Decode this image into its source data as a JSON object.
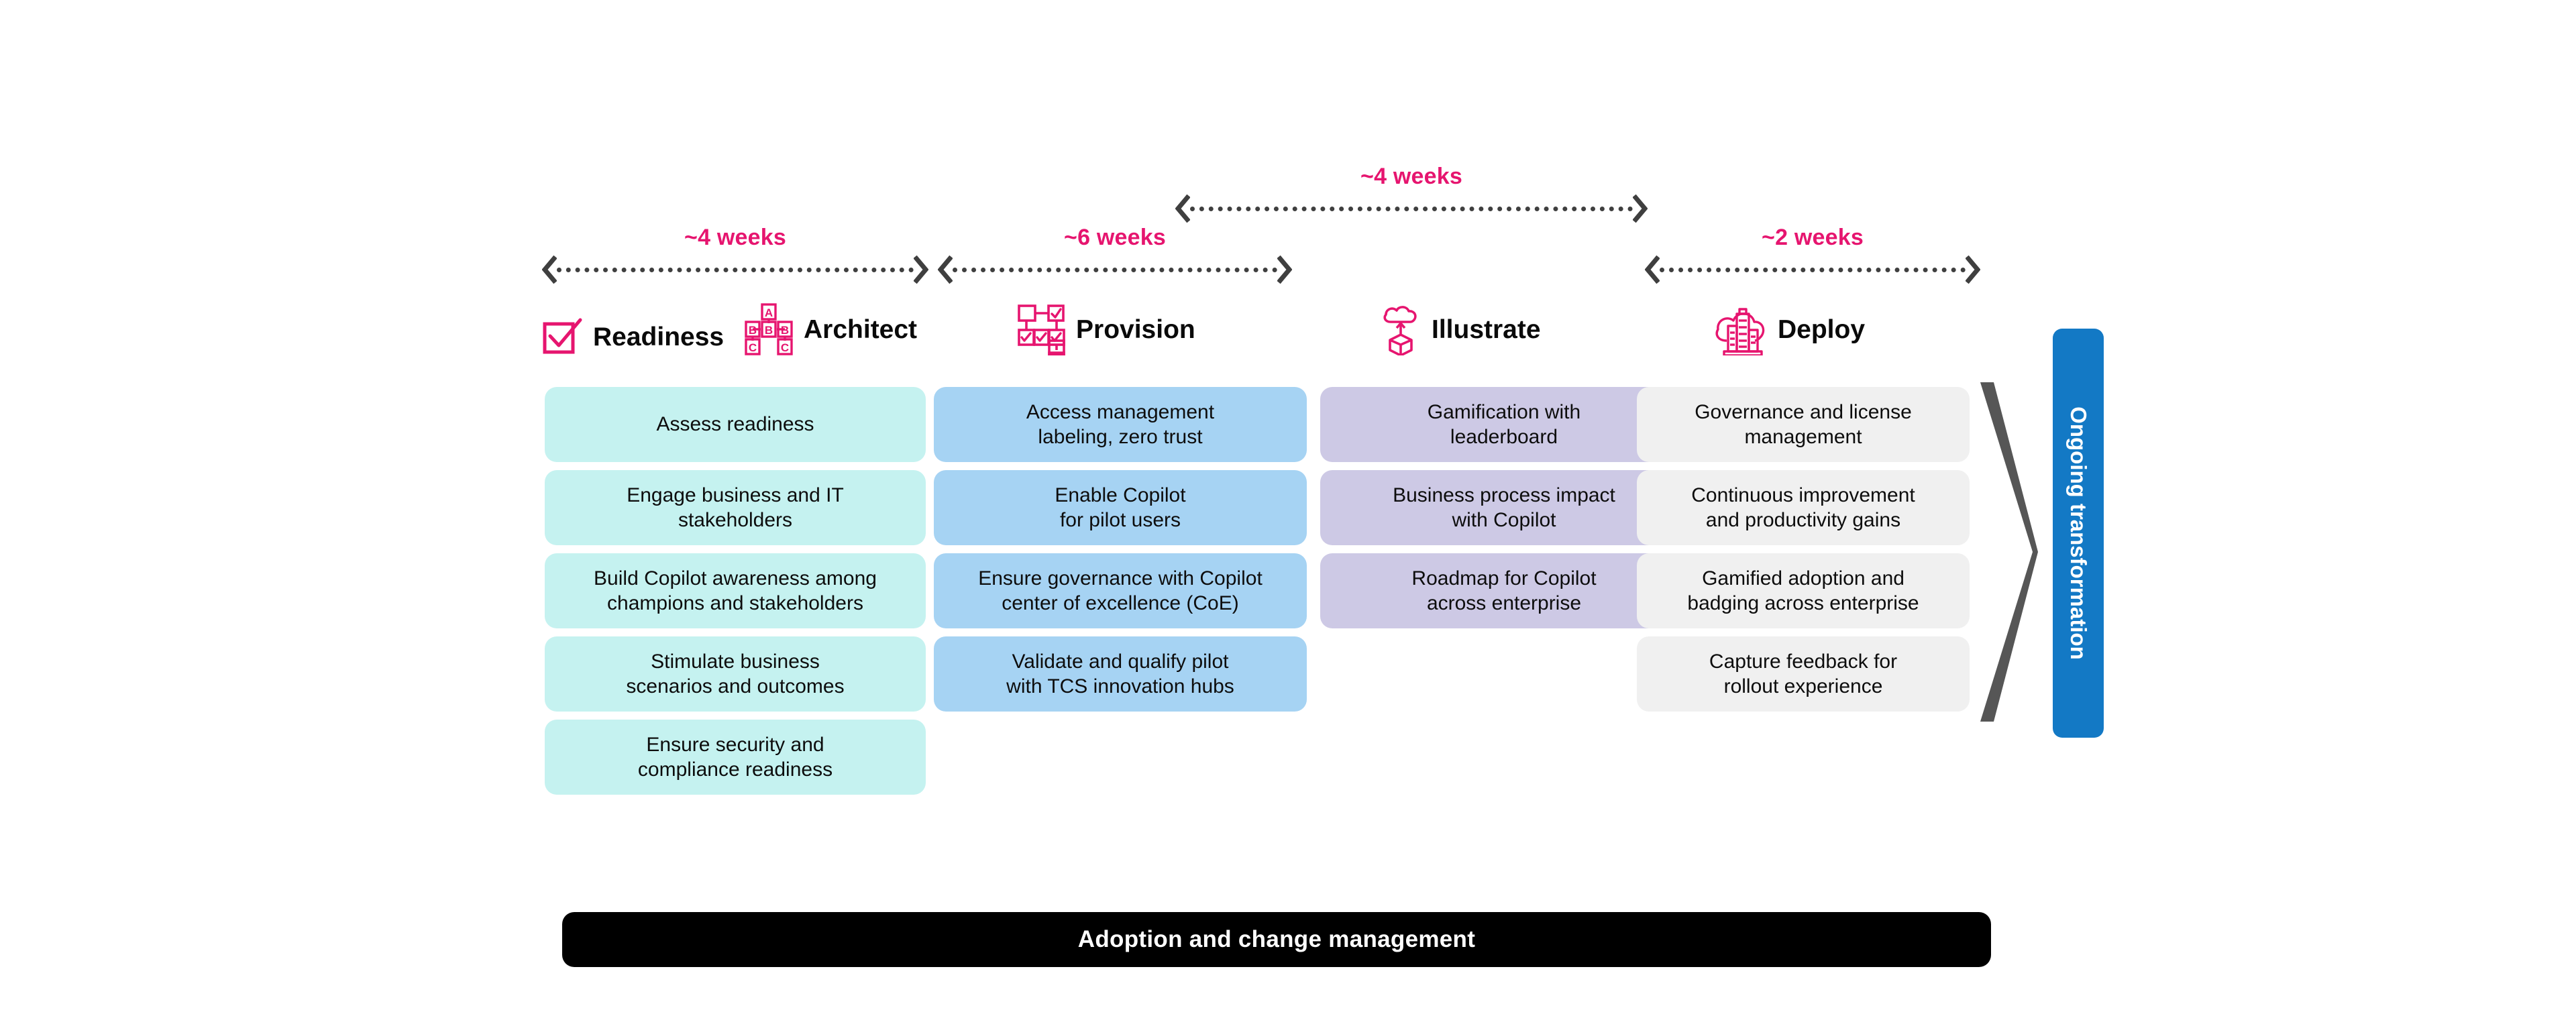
{
  "accent": {
    "pink": "#E6156F",
    "arrow_gray": "#3F3F3F",
    "big_chevron_gray": "#565656",
    "ongoing_blue": "#1379C5",
    "card_teal": "#C5F2F0",
    "card_blue": "#A6D3F3",
    "card_purple": "#CDC9E5",
    "card_gray": "#F0F0F0",
    "bar_black": "#000000"
  },
  "durations": [
    {
      "id": "d1",
      "label": "~4 weeks"
    },
    {
      "id": "d2",
      "label": "~6 weeks"
    },
    {
      "id": "d3",
      "label": "~4 weeks"
    },
    {
      "id": "d4",
      "label": "~2 weeks"
    }
  ],
  "phases": [
    {
      "id": "readiness",
      "title": "Readiness",
      "icon": "checkbox-check-icon",
      "card_style": "teal",
      "items": [
        "Assess readiness",
        "Engage business and IT\nstakeholders",
        "Build Copilot awareness among\nchampions and stakeholders",
        "Stimulate business\nscenarios and outcomes",
        "Ensure security and\ncompliance readiness"
      ]
    },
    {
      "id": "architect",
      "title": "Architect",
      "icon": "org-chart-abc-icon",
      "card_style": "teal",
      "items": []
    },
    {
      "id": "provision",
      "title": "Provision",
      "icon": "checklist-nodes-icon",
      "card_style": "blue",
      "items": [
        "Access management\nlabeling, zero trust",
        "Enable Copilot\nfor pilot users",
        "Ensure governance with Copilot\ncenter of excellence (CoE)",
        "Validate and qualify pilot\nwith TCS innovation hubs"
      ]
    },
    {
      "id": "illustrate",
      "title": "Illustrate",
      "icon": "cloud-upload-cube-icon",
      "card_style": "purple",
      "items": [
        "Gamification with\nleaderboard",
        "Business process impact\nwith Copilot",
        "Roadmap for Copilot\nacross enterprise"
      ]
    },
    {
      "id": "deploy",
      "title": "Deploy",
      "icon": "cloud-buildings-icon",
      "card_style": "gray",
      "items": [
        "Governance and license\nmanagement",
        "Continuous improvement\nand productivity gains",
        "Gamified adoption and\nbadging across enterprise",
        "Capture feedback for\nrollout experience"
      ]
    }
  ],
  "ongoing": {
    "label": "Ongoing transformation"
  },
  "bottom_bar": {
    "label": "Adoption and change management"
  }
}
